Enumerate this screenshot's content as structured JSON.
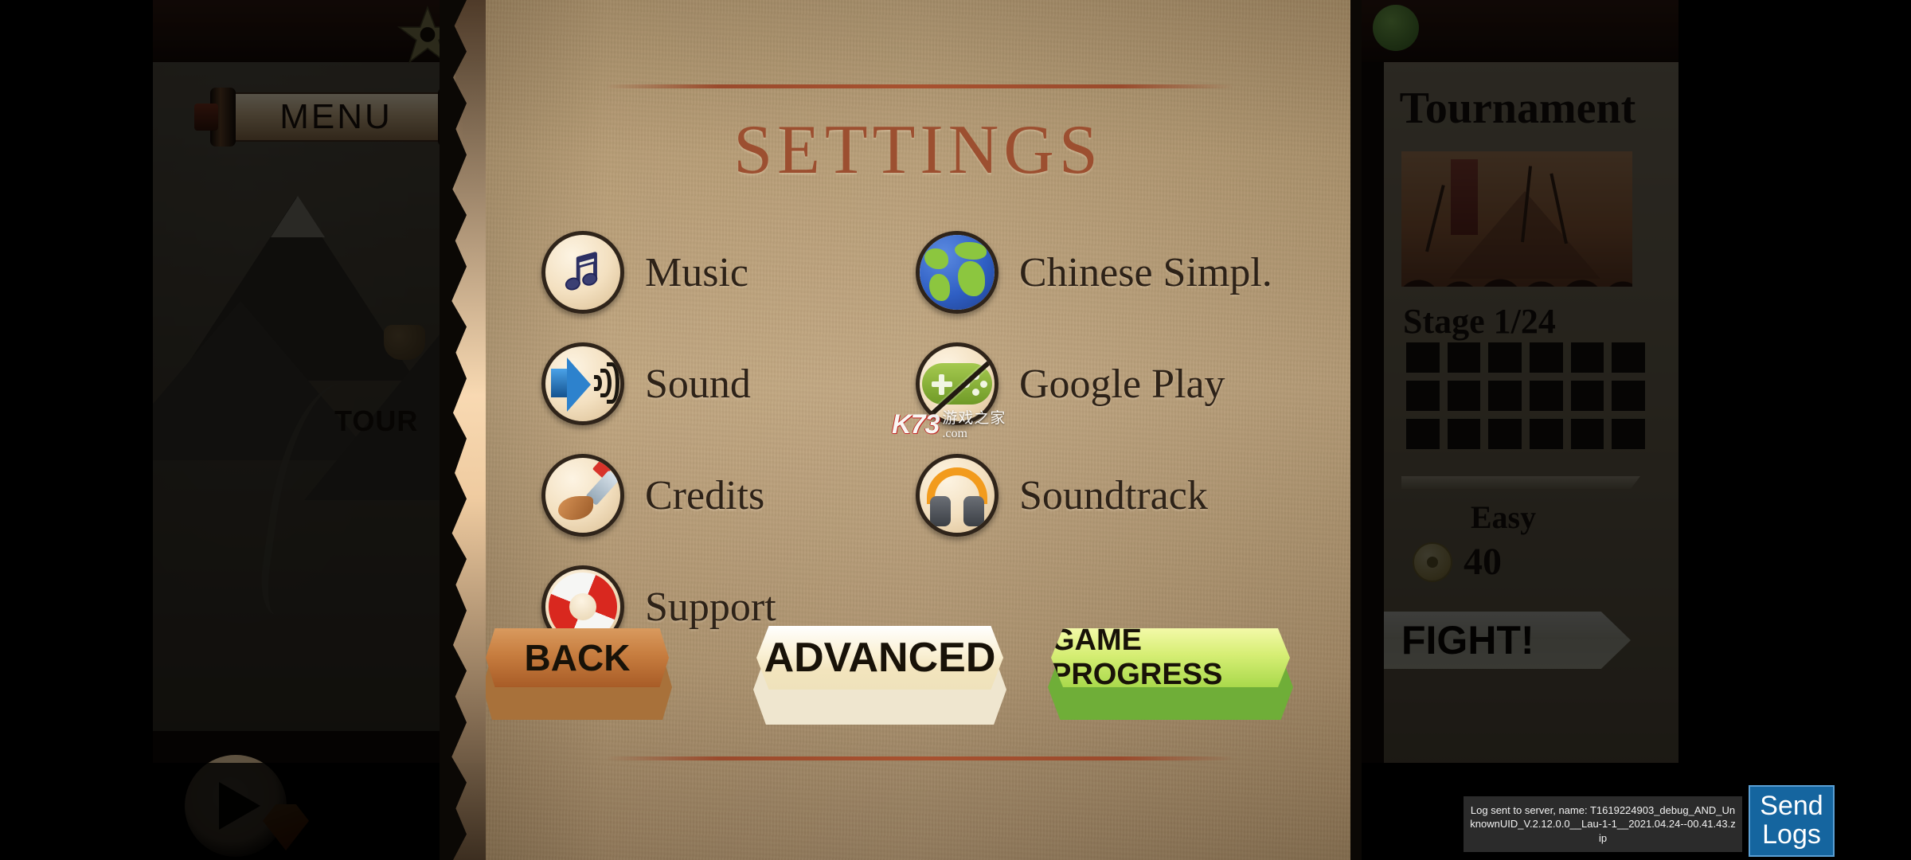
{
  "background": {
    "left_panel": {
      "menu_label": "MENU",
      "map_label": "TOUR",
      "star_icon": "shuriken-star-icon",
      "play_icon": "play-button-icon",
      "gem_icon": "gem-icon"
    },
    "right_panel": {
      "title": "Tournament",
      "stage_label": "Stage 1/24",
      "difficulty": "Easy",
      "coin_amount": "40",
      "fight_label": "FIGHT!",
      "stage_cells": 18,
      "leaf_icon": "leaf-badge-icon"
    }
  },
  "modal": {
    "title": "SETTINGS",
    "options_left": [
      {
        "label": "Music",
        "icon": "music-note-icon",
        "disabled": false
      },
      {
        "label": "Sound",
        "icon": "speaker-icon",
        "disabled": false
      },
      {
        "label": "Credits",
        "icon": "paintbrush-icon",
        "disabled": false
      },
      {
        "label": "Support",
        "icon": "life-ring-icon",
        "disabled": false
      }
    ],
    "options_right": [
      {
        "label": "Chinese Simpl.",
        "icon": "globe-icon",
        "disabled": false
      },
      {
        "label": "Google Play",
        "icon": "gamepad-icon",
        "disabled": true
      },
      {
        "label": "Soundtrack",
        "icon": "headphones-icon",
        "disabled": false
      }
    ],
    "buttons": {
      "back": "BACK",
      "advanced": "ADVANCED",
      "game_progress": "GAME PROGRESS"
    },
    "colors": {
      "title": "#9c4f30",
      "paper": "#bfa47d",
      "rule": "#a8512f",
      "back_button": "#c77d3f",
      "advanced_button": "#f2e4bd",
      "progress_button": "#a9d94c"
    }
  },
  "watermark": {
    "brand": "K73",
    "chinese": "游戏之家",
    "domain": ".com"
  },
  "log_toast": {
    "message": "Log sent to server, name: T1619224903_debug_AND_UnknownUID_V.2.12.0.0__Lau-1-1__2021.04.24--00.41.43.zip",
    "send_button_line1": "Send",
    "send_button_line2": "Logs",
    "accent": "#15659f"
  }
}
